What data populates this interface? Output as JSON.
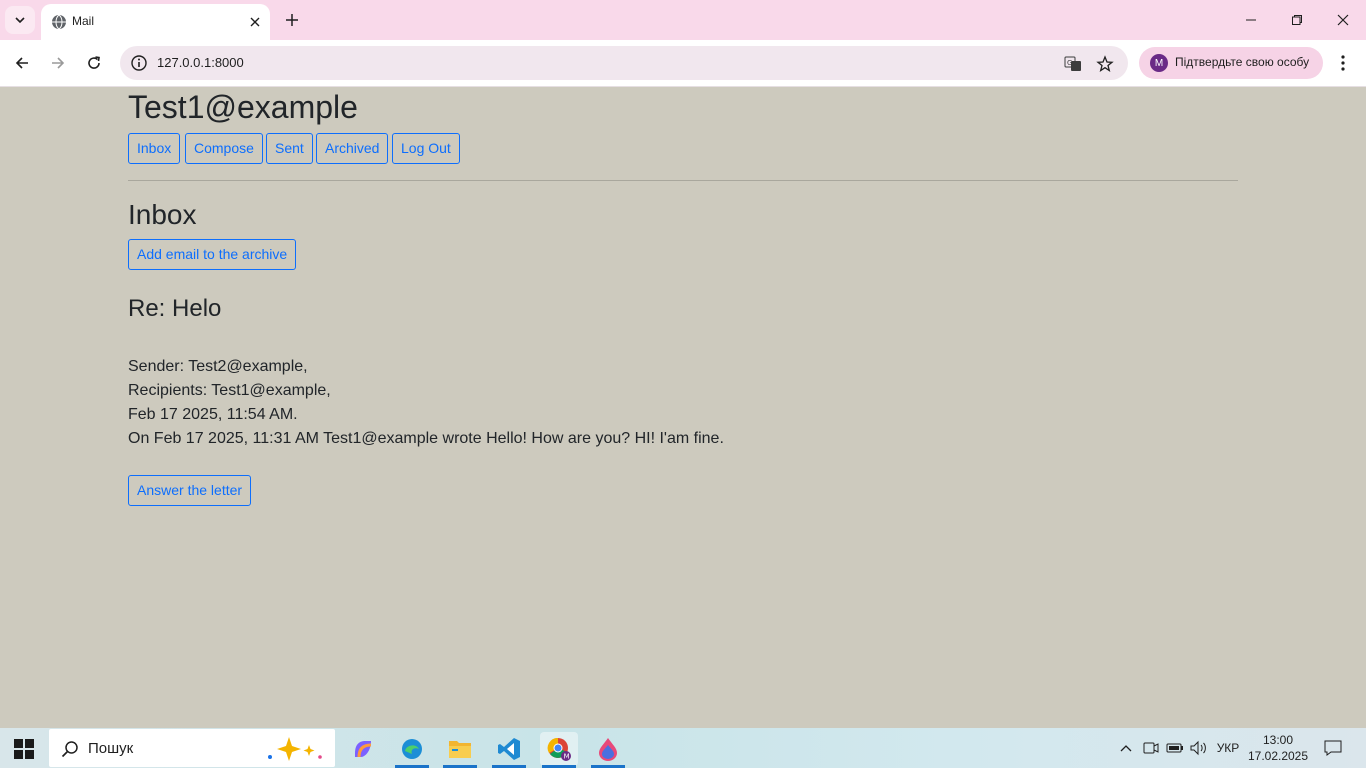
{
  "browser": {
    "tab_title": "Mail",
    "url": "127.0.0.1:8000",
    "profile_initial": "M",
    "profile_label": "Підтвердьте свою особу"
  },
  "app": {
    "user": "Test1@example",
    "nav": {
      "inbox": "Inbox",
      "compose": "Compose",
      "sent": "Sent",
      "archived": "Archived",
      "logout": "Log Out"
    }
  },
  "mailbox": {
    "title": "Inbox",
    "archive_button": "Add email to the archive"
  },
  "email": {
    "subject": "Re: Helo",
    "sender": "Sender: Test2@example,",
    "recipients": "Recipients: Test1@example,",
    "timestamp": "Feb 17 2025, 11:54 AM.",
    "body": "On Feb 17 2025, 11:31 AM Test1@example wrote Hello! How are you? HI! I'am fine.",
    "reply_button": "Answer the letter"
  },
  "taskbar": {
    "search_placeholder": "Пошук",
    "language": "УКР",
    "time": "13:00",
    "date": "17.02.2025"
  },
  "colors": {
    "page_bg": "#cdcabe",
    "accent": "#0d6efd",
    "tabstrip": "#f9d9ea"
  }
}
